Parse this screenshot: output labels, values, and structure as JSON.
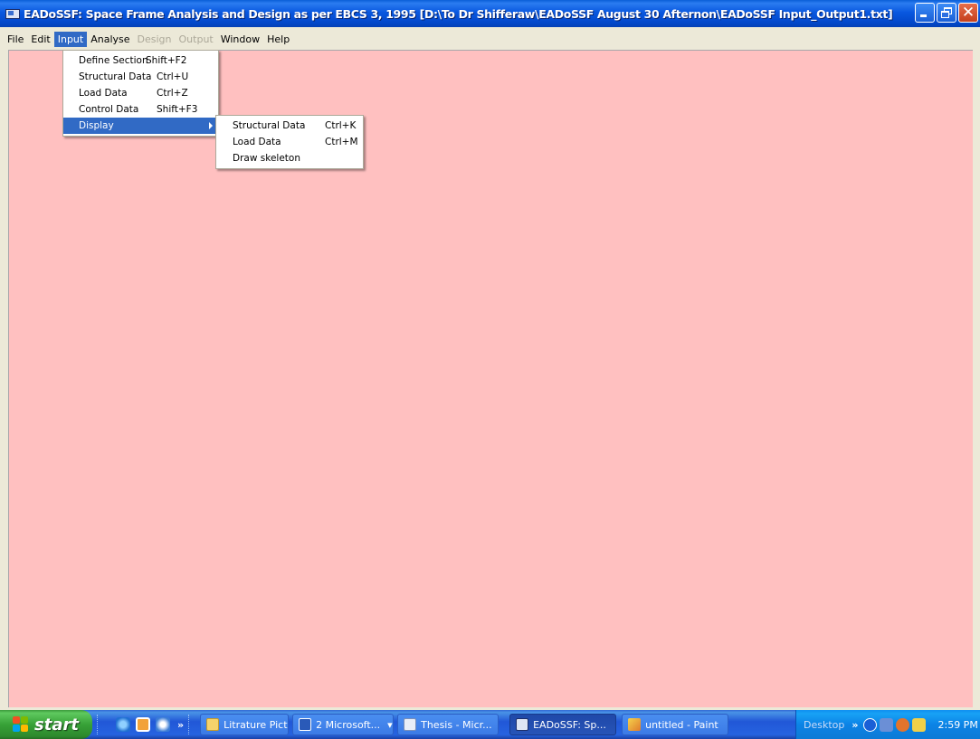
{
  "window": {
    "title": "EADoSSF: Space Frame Analysis and Design as per EBCS 3, 1995 [D:\\To Dr Shifferaw\\EADoSSF August 30 Afternon\\EADoSSF Input_Output1.txt]",
    "client_background": "#ffc0c0"
  },
  "menubar": {
    "items": [
      {
        "label": "File",
        "state": "normal"
      },
      {
        "label": "Edit",
        "state": "normal"
      },
      {
        "label": "Input",
        "state": "active"
      },
      {
        "label": "Analyse",
        "state": "normal"
      },
      {
        "label": "Design",
        "state": "disabled"
      },
      {
        "label": "Output",
        "state": "disabled"
      },
      {
        "label": "Window",
        "state": "normal"
      },
      {
        "label": "Help",
        "state": "normal"
      }
    ]
  },
  "input_menu": {
    "items": [
      {
        "label": "Define Section",
        "shortcut": "Shift+F2"
      },
      {
        "label": "Structural Data",
        "shortcut": "Ctrl+U"
      },
      {
        "label": "Load Data",
        "shortcut": "Ctrl+Z"
      },
      {
        "label": "Control Data",
        "shortcut": "Shift+F3"
      },
      {
        "label": "Display",
        "shortcut": "",
        "submenu": true
      }
    ]
  },
  "display_submenu": {
    "items": [
      {
        "label": "Structural Data",
        "shortcut": "Ctrl+K"
      },
      {
        "label": "Load Data",
        "shortcut": "Ctrl+M"
      },
      {
        "label": "Draw skeleton",
        "shortcut": ""
      }
    ]
  },
  "taskbar": {
    "start_label": "start",
    "tasks": [
      {
        "label": "Litrature Pict...",
        "icon": "folder-icon"
      },
      {
        "label": "2 Microsoft...",
        "icon": "word-icon",
        "dropdown": "▾"
      },
      {
        "label": "Thesis - Micr...",
        "icon": "document-icon"
      },
      {
        "label": "EADoSSF: Sp...",
        "icon": "app-icon",
        "active": true
      },
      {
        "label": "untitled - Paint",
        "icon": "paint-icon"
      }
    ],
    "tray": {
      "desktop_label": "Desktop",
      "clock": "2:59 PM"
    }
  }
}
